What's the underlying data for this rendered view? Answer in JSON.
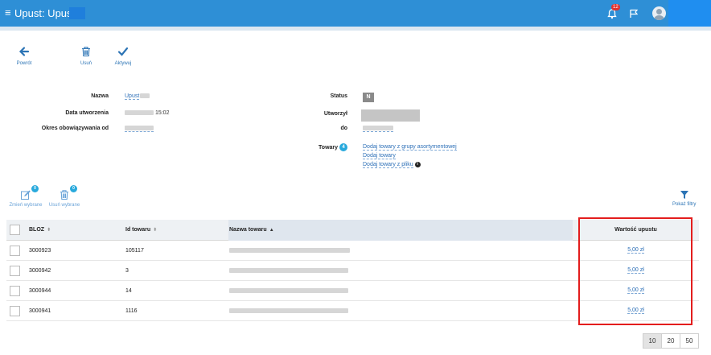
{
  "header": {
    "menu_icon": "hamburger-icon",
    "title": "Upust: Upust",
    "notifications_count": "12",
    "bell_icon": "bell-icon",
    "flag_icon": "flag-icon",
    "avatar_icon": "user-avatar-icon",
    "brand_color": "#2e8fd6"
  },
  "toolbar": {
    "back_label": "Powrót",
    "delete_label": "Usuń",
    "activate_label": "Aktywuj"
  },
  "details": {
    "name_label": "Nazwa",
    "name_value": "Upust",
    "created_label": "Data utworzenia",
    "created_time": "15:02",
    "valid_from_label": "Okres obowiązywania od",
    "status_label": "Status",
    "status_value": "N",
    "created_by_label": "Utworzył",
    "valid_to_label": "do",
    "products_label": "Towary",
    "products_count": "4",
    "links": [
      "Dodaj towary z grupy asortymentowej",
      "Dodaj towary",
      "Dodaj towary z pliku"
    ]
  },
  "actions": {
    "edit_selected_label": "Zmień wybrane",
    "edit_selected_count": "0",
    "delete_selected_label": "Usuń wybrane",
    "delete_selected_count": "0",
    "filters_label": "Pokaż filtry"
  },
  "table": {
    "columns": [
      "BLOZ",
      "Id towaru",
      "Nazwa towaru",
      "Wartość upustu"
    ],
    "rows": [
      {
        "bloz": "3000923",
        "id": "105117",
        "value": "5,00 zł"
      },
      {
        "bloz": "3000942",
        "id": "3",
        "value": "5,00 zł"
      },
      {
        "bloz": "3000944",
        "id": "14",
        "value": "5,00 zł"
      },
      {
        "bloz": "3000941",
        "id": "1116",
        "value": "5,00 zł"
      }
    ]
  },
  "pagination": {
    "options": [
      "10",
      "20",
      "50"
    ],
    "selected": "10"
  },
  "highlight_color": "#e31d1d"
}
